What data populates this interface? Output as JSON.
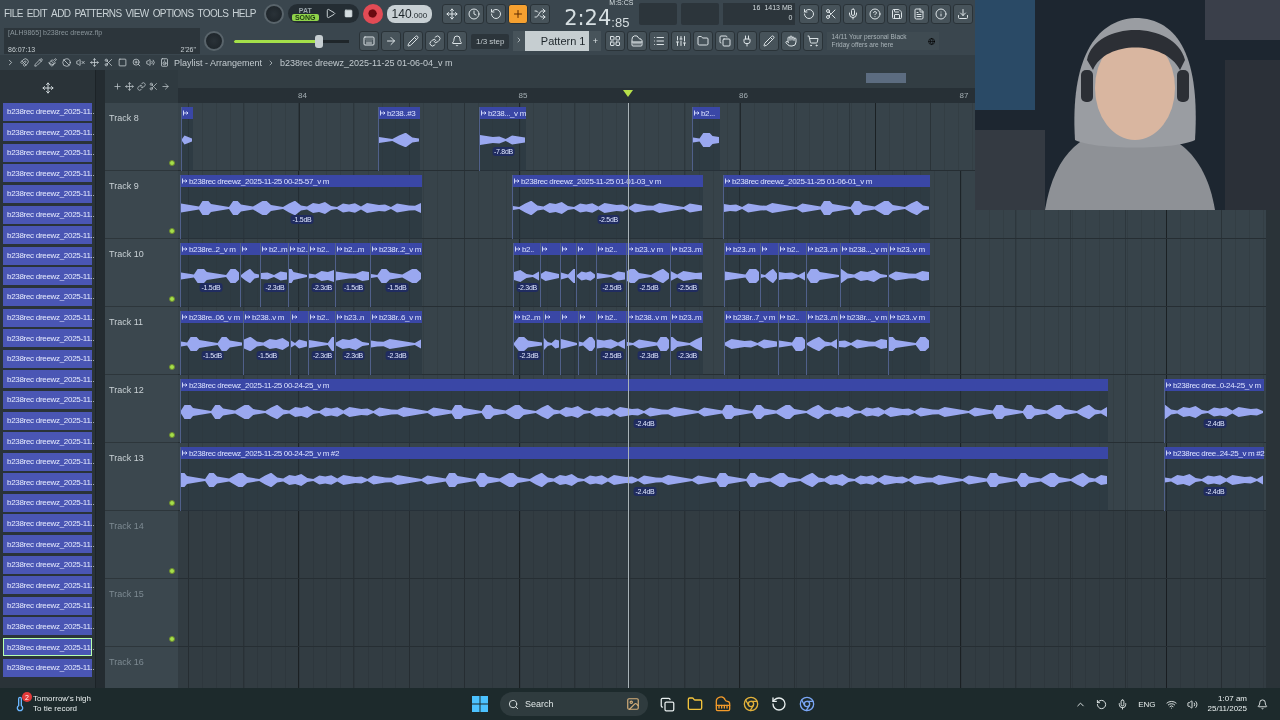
{
  "menu": [
    "FILE",
    "EDIT",
    "ADD",
    "PATTERNS",
    "VIEW",
    "OPTIONS",
    "TOOLS",
    "HELP"
  ],
  "project": {
    "name": "[ALH9865] b238rec dreewz.flp",
    "position": "86:07:13",
    "duration": "2'26\""
  },
  "transport": {
    "modes": [
      {
        "label": "PAT",
        "selected": false
      },
      {
        "label": "SONG",
        "selected": true
      }
    ],
    "recording": true,
    "tempo": "140",
    "tempo_fraction": ".000"
  },
  "master_volume": {
    "level": 0.74
  },
  "snap_buttons": [
    {
      "on": false
    },
    {
      "on": false
    },
    {
      "on": false
    },
    {
      "on": true
    },
    {
      "on": false
    }
  ],
  "time": {
    "value": "2:24",
    "centiseconds": ":85",
    "format": "M:S:CS"
  },
  "memory": {
    "polyphony": "16",
    "ram": "1413 MB",
    "cpu": "0"
  },
  "step": "1/3 step",
  "pattern": {
    "name": "Pattern 1",
    "add": "+"
  },
  "news": "14/11  Your personal Black Friday offers are here",
  "playlist": {
    "title": "Playlist - Arrangement",
    "clip": "b238rec dreewz_2025-11-25 01-06-04_v m"
  },
  "browser": [
    {
      "label": "b238rec dreewz_2025-11..",
      "selected": false
    },
    {
      "label": "b238rec dreewz_2025-11..",
      "selected": false
    },
    {
      "label": "b238rec dreewz_2025-11..",
      "selected": false
    },
    {
      "label": "b238rec dreewz_2025-11..",
      "selected": false
    },
    {
      "label": "b238rec dreewz_2025-11..",
      "selected": false
    },
    {
      "label": "b238rec dreewz_2025-11..",
      "selected": false
    },
    {
      "label": "b238rec dreewz_2025-11..",
      "selected": false
    },
    {
      "label": "b238rec dreewz_2025-11..",
      "selected": false
    },
    {
      "label": "b238rec dreewz_2025-11..",
      "selected": false
    },
    {
      "label": "b238rec dreewz_2025-11..",
      "selected": false
    },
    {
      "label": "b238rec dreewz_2025-11..",
      "selected": false
    },
    {
      "label": "b238rec dreewz_2025-11..",
      "selected": false
    },
    {
      "label": "b238rec dreewz_2025-11..",
      "selected": false
    },
    {
      "label": "b238rec dreewz_2025-11..",
      "selected": false
    },
    {
      "label": "b238rec dreewz_2025-11..",
      "selected": false
    },
    {
      "label": "b238rec dreewz_2025-11..",
      "selected": false
    },
    {
      "label": "b238rec dreewz_2025-11..",
      "selected": false
    },
    {
      "label": "b238rec dreewz_2025-11..",
      "selected": false
    },
    {
      "label": "b238rec dreewz_2025-11..",
      "selected": false
    },
    {
      "label": "b238rec dreewz_2025-11..",
      "selected": false
    },
    {
      "label": "b238rec dreewz_2025-11..",
      "selected": false
    },
    {
      "label": "b238rec dreewz_2025-11..",
      "selected": false
    },
    {
      "label": "b238rec dreewz_2025-11..",
      "selected": false
    },
    {
      "label": "b238rec dreewz_2025-11..",
      "selected": false
    },
    {
      "label": "b238rec dreewz_2025-11..",
      "selected": false
    },
    {
      "label": "b238rec dreewz_2025-11..",
      "selected": false
    },
    {
      "label": "b238rec dreewz_2025-11..",
      "selected": true
    },
    {
      "label": "b238rec dreewz_2025-11..",
      "selected": false
    }
  ],
  "ruler": [
    "84",
    "85",
    "86",
    "87"
  ],
  "tracks": [
    {
      "name": "Track 8",
      "empty": false,
      "clips": [
        {
          "kind": "blank"
        },
        {
          "kind": "named",
          "label": "b238..#3"
        },
        {
          "kind": "named",
          "label": "b238..._v m",
          "gain": "-7.8dB"
        },
        {
          "kind": "named",
          "label": "b2..."
        }
      ]
    },
    {
      "name": "Track 9",
      "empty": false,
      "clips": [
        {
          "kind": "named",
          "label": "b238rec dreewz_2025-11-25 00-25-57_v m",
          "gain": "-1.5dB"
        },
        {
          "kind": "named",
          "label": "b238rec dreewz_2025-11-25 01-01-03_v m",
          "gain": "-2.5dB"
        },
        {
          "kind": "named",
          "label": "b238rec dreewz_2025-11-25 01-06-01_v m"
        }
      ]
    },
    {
      "name": "Track 10",
      "empty": false,
      "clips": [
        {
          "kind": "named",
          "label": "b238re..2_v m",
          "gain": "-1.5dB"
        },
        {
          "kind": "blank"
        },
        {
          "kind": "named",
          "label": "b2..m",
          "gain": "-2.3dB"
        },
        {
          "kind": "named",
          "label": "b2.."
        },
        {
          "kind": "named",
          "label": "b2..",
          "gain": "-2.3dB"
        },
        {
          "kind": "named",
          "label": "b2...m",
          "gain": "-1.5dB"
        },
        {
          "kind": "named",
          "label": "b238r..2_v m",
          "gain": "-1.5dB"
        },
        {
          "kind": "named",
          "label": "b2..",
          "gain": "-2.3dB"
        },
        {
          "kind": "blank"
        },
        {
          "kind": "blank"
        },
        {
          "kind": "blank"
        },
        {
          "kind": "named",
          "label": "b2..",
          "gain": "-2.5dB"
        },
        {
          "kind": "named",
          "label": "b23..v m",
          "gain": "-2.5dB"
        },
        {
          "kind": "named",
          "label": "b23..m",
          "gain": "-2.5dB"
        },
        {
          "kind": "named",
          "label": "b23..m"
        },
        {
          "kind": "blank"
        },
        {
          "kind": "named",
          "label": "b2.."
        },
        {
          "kind": "named",
          "label": "b23..m"
        },
        {
          "kind": "named",
          "label": "b238..._v m"
        },
        {
          "kind": "named",
          "label": "b23..v m"
        }
      ]
    },
    {
      "name": "Track 11",
      "empty": false,
      "clips": [
        {
          "kind": "named",
          "label": "b238re..06_v m",
          "gain": "-1.5dB"
        },
        {
          "kind": "named",
          "label": "b238..v m",
          "gain": "-1.5dB"
        },
        {
          "kind": "blank"
        },
        {
          "kind": "named",
          "label": "b2..",
          "gain": "-2.3dB"
        },
        {
          "kind": "named",
          "label": "b23..n",
          "gain": "-2.3dB"
        },
        {
          "kind": "named",
          "label": "b238r..6_v m",
          "gain": "-2.3dB"
        },
        {
          "kind": "named",
          "label": "b2..m",
          "gain": "-2.3dB"
        },
        {
          "kind": "blank"
        },
        {
          "kind": "blank"
        },
        {
          "kind": "blank"
        },
        {
          "kind": "named",
          "label": "b2..",
          "gain": "-2.5dB"
        },
        {
          "kind": "named",
          "label": "b238..v m",
          "gain": "-2.3dB"
        },
        {
          "kind": "named",
          "label": "b23..m",
          "gain": "-2.3dB"
        },
        {
          "kind": "named",
          "label": "b238r..7_v m"
        },
        {
          "kind": "named",
          "label": "b2.."
        },
        {
          "kind": "named",
          "label": "b23..m"
        },
        {
          "kind": "named",
          "label": "b238r..._v m"
        },
        {
          "kind": "named",
          "label": "b23..v m"
        }
      ]
    },
    {
      "name": "Track 12",
      "empty": false,
      "clips": [
        {
          "kind": "named",
          "label": "b238rec dreewz_2025-11-25 00-24-25_v m",
          "gain": "-2.4dB"
        },
        {
          "kind": "named",
          "label": "b238rec dree..0-24-25_v m",
          "gain": "-2.4dB"
        }
      ]
    },
    {
      "name": "Track 13",
      "empty": false,
      "clips": [
        {
          "kind": "named",
          "label": "b238rec dreewz_2025-11-25 00-24-25_v m #2",
          "gain": "-2.4dB"
        },
        {
          "kind": "named",
          "label": "b238rec dree..24-25_v m #2",
          "gain": "-2.4dB"
        }
      ]
    },
    {
      "name": "Track 14",
      "empty": true
    },
    {
      "name": "Track 15",
      "empty": true
    },
    {
      "name": "Track 16",
      "empty": true
    }
  ],
  "webcam": {
    "kind": "picture"
  },
  "taskbar": {
    "weather": {
      "badge": "2",
      "title": "Tomorrow's high",
      "subtitle": "To tie record"
    },
    "search": "Search",
    "language": "ENG",
    "time": "1:07 am",
    "date": "25/11/2025"
  }
}
